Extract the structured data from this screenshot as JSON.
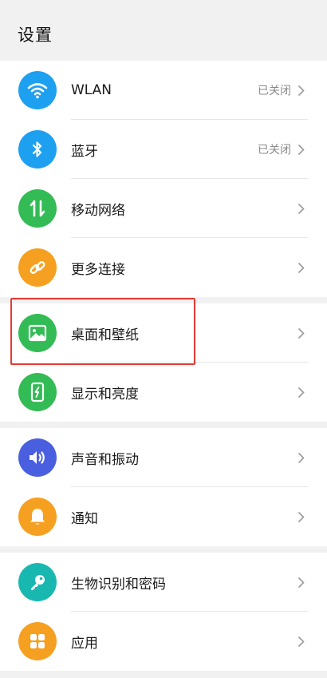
{
  "header": {
    "title": "设置"
  },
  "groups": [
    {
      "items": [
        {
          "label": "WLAN",
          "status": "已关闭",
          "icon": "wifi-icon",
          "color": "#1ea0f0"
        },
        {
          "label": "蓝牙",
          "status": "已关闭",
          "icon": "bluetooth-icon",
          "color": "#1ea0f0"
        },
        {
          "label": "移动网络",
          "icon": "mobile-data-icon",
          "color": "#33bb55"
        },
        {
          "label": "更多连接",
          "icon": "link-icon",
          "color": "#f5a020"
        }
      ]
    },
    {
      "items": [
        {
          "label": "桌面和壁纸",
          "icon": "image-icon",
          "color": "#33bb55"
        },
        {
          "label": "显示和亮度",
          "icon": "phone-brightness-icon",
          "color": "#33bb55"
        }
      ]
    },
    {
      "items": [
        {
          "label": "声音和振动",
          "icon": "speaker-icon",
          "color": "#4a5fe0"
        },
        {
          "label": "通知",
          "icon": "bell-icon",
          "color": "#f5a020"
        }
      ]
    },
    {
      "items": [
        {
          "label": "生物识别和密码",
          "icon": "key-icon",
          "color": "#18b8b0"
        },
        {
          "label": "应用",
          "icon": "apps-grid-icon",
          "color": "#f5a020"
        }
      ]
    }
  ],
  "highlight": {
    "target": "桌面和壁纸",
    "color": "#e53935"
  }
}
